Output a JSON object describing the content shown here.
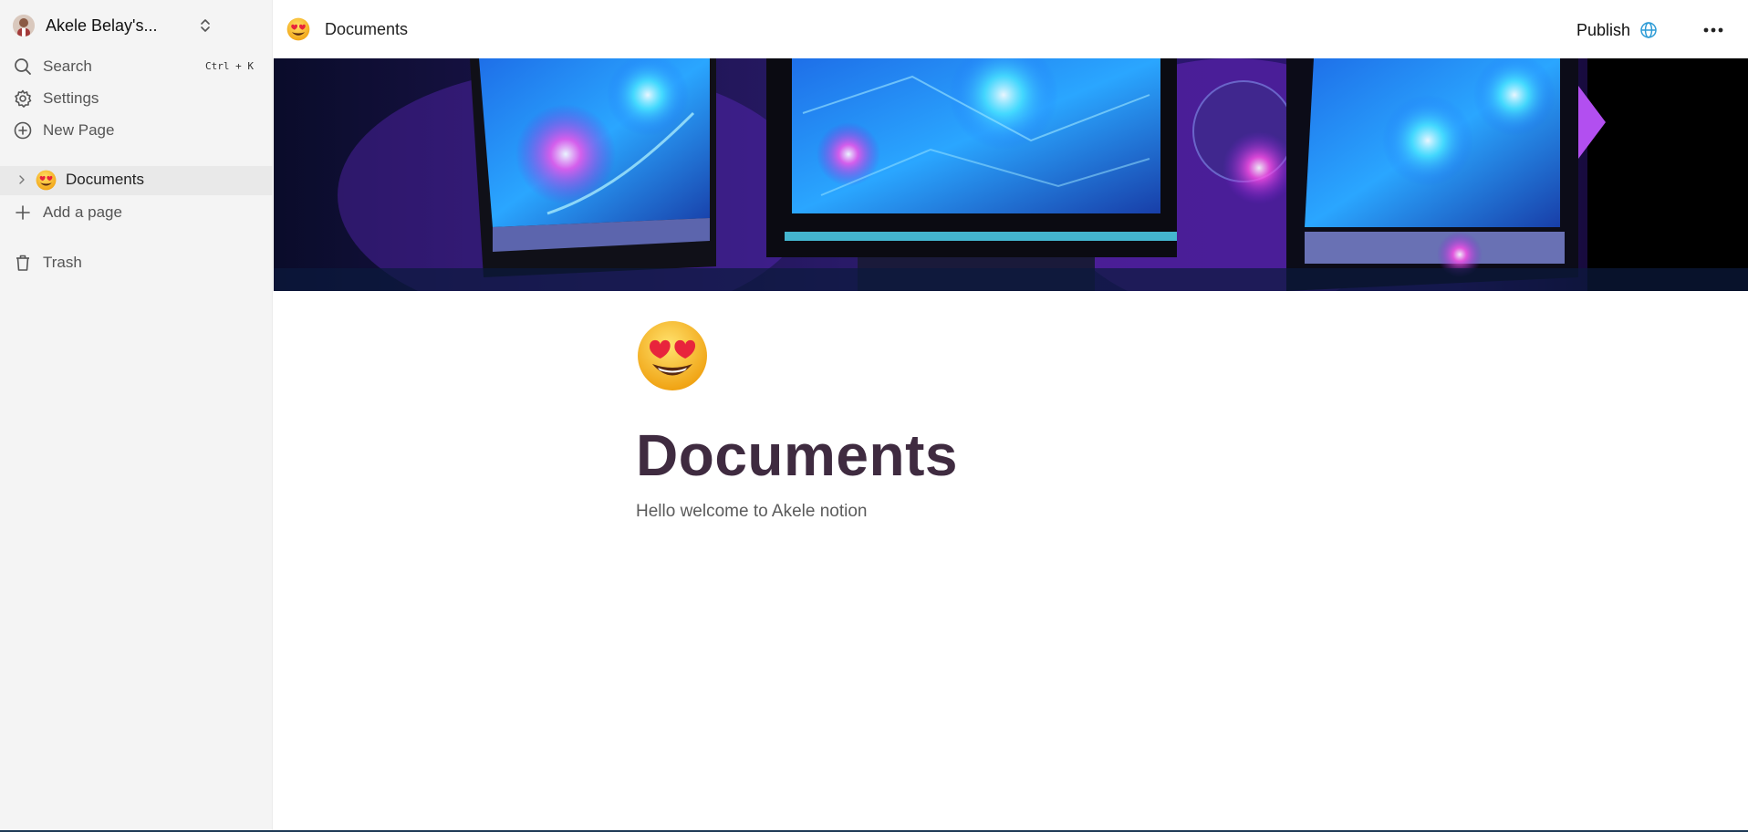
{
  "sidebar": {
    "workspace_name": "Akele Belay's...",
    "search_label": "Search",
    "search_shortcut": "Ctrl + K",
    "settings_label": "Settings",
    "new_page_label": "New Page",
    "pages": [
      {
        "emoji": "heart-eyes-emoji",
        "label": "Documents"
      }
    ],
    "add_page_label": "Add a page",
    "trash_label": "Trash"
  },
  "topbar": {
    "breadcrumb_label": "Documents",
    "publish_label": "Publish"
  },
  "document": {
    "icon": "heart-eyes-emoji",
    "title": "Documents",
    "body": "Hello welcome to Akele notion"
  },
  "colors": {
    "sidebar_bg": "#f4f4f4",
    "selected_row_bg": "#e9e9e9",
    "title": "#3f2b40",
    "publish_globe": "#2d9bd6"
  }
}
